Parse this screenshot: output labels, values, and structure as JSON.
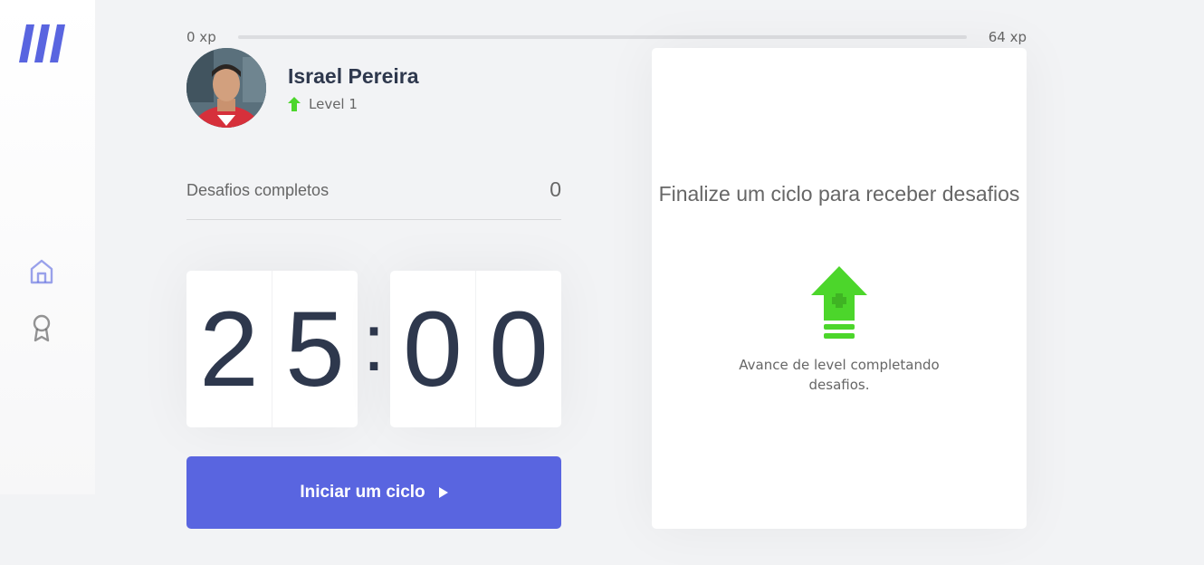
{
  "sidebar": {
    "logo_icon": "app-logo",
    "nav": [
      {
        "icon": "home-icon",
        "active": true
      },
      {
        "icon": "award-icon",
        "active": false
      }
    ]
  },
  "xp": {
    "current_label": "0 xp",
    "max_label": "64 xp",
    "progress": 0
  },
  "profile": {
    "name": "Israel Pereira",
    "level_label": "Level 1"
  },
  "challenges": {
    "label": "Desafios completos",
    "value": "0"
  },
  "timer": {
    "minutes_tens": "2",
    "minutes_ones": "5",
    "separator": ":",
    "seconds_tens": "0",
    "seconds_ones": "0"
  },
  "start_button": {
    "label": "Iniciar um ciclo"
  },
  "challenge_box": {
    "title": "Finalize um ciclo para receber desafios",
    "hint": "Avance de level completando desafios."
  },
  "colors": {
    "accent": "#5965e0",
    "green": "#4cd62b",
    "text": "#666666",
    "title": "#2e384d",
    "background": "#f2f3f5"
  }
}
